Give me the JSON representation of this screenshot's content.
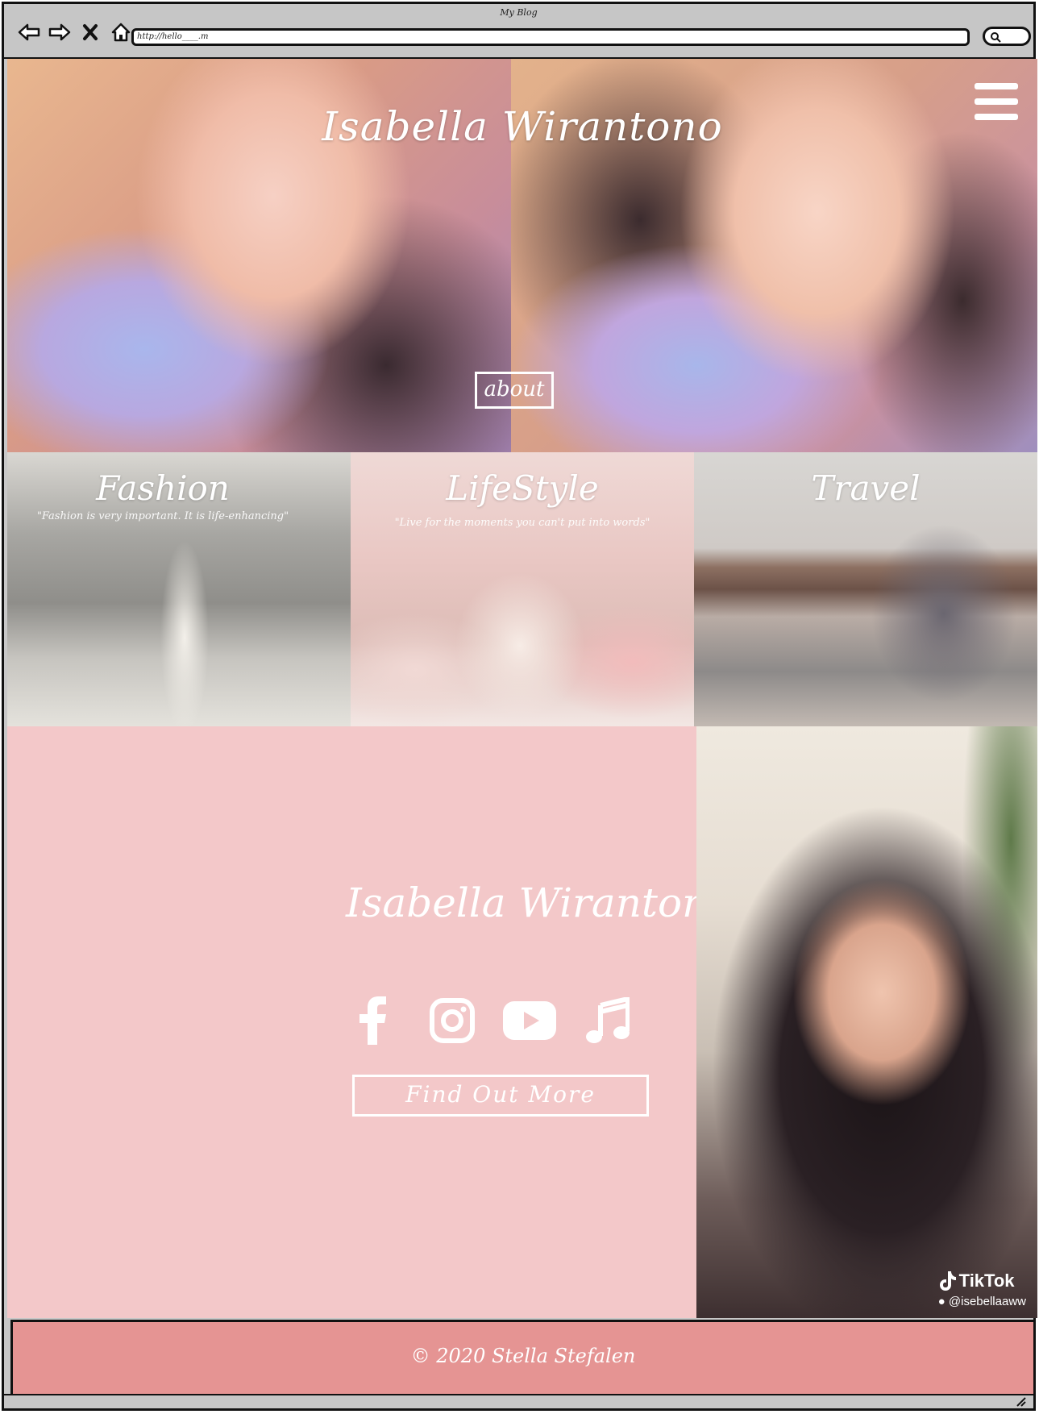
{
  "browser": {
    "window_title": "My Blog",
    "url": "http://hello____.m",
    "icons": [
      "back-icon",
      "forward-icon",
      "close-icon",
      "home-icon",
      "search-icon"
    ]
  },
  "hero": {
    "title": "Isabella Wirantono",
    "about_label": "about",
    "menu_icon": "hamburger-menu-icon"
  },
  "categories": [
    {
      "title": "Fashion",
      "subtitle": "\"Fashion is very important. It is life-enhancing\""
    },
    {
      "title": "LifeStyle",
      "subtitle": "\"Live for the moments you can't put into words\""
    },
    {
      "title": "Travel",
      "subtitle": ""
    }
  ],
  "profile": {
    "name": "Isabella Wirantono",
    "socials": [
      "facebook-icon",
      "instagram-icon",
      "youtube-icon",
      "music-note-icon"
    ],
    "cta_label": "Find Out More",
    "background_color": "#f3c8c9"
  },
  "portrait": {
    "tiktok_brand": "TikTok",
    "tiktok_handle": "@isebellaaww"
  },
  "footer": {
    "text": "© 2020 Stella Stefalen",
    "background_color": "#e59493"
  }
}
